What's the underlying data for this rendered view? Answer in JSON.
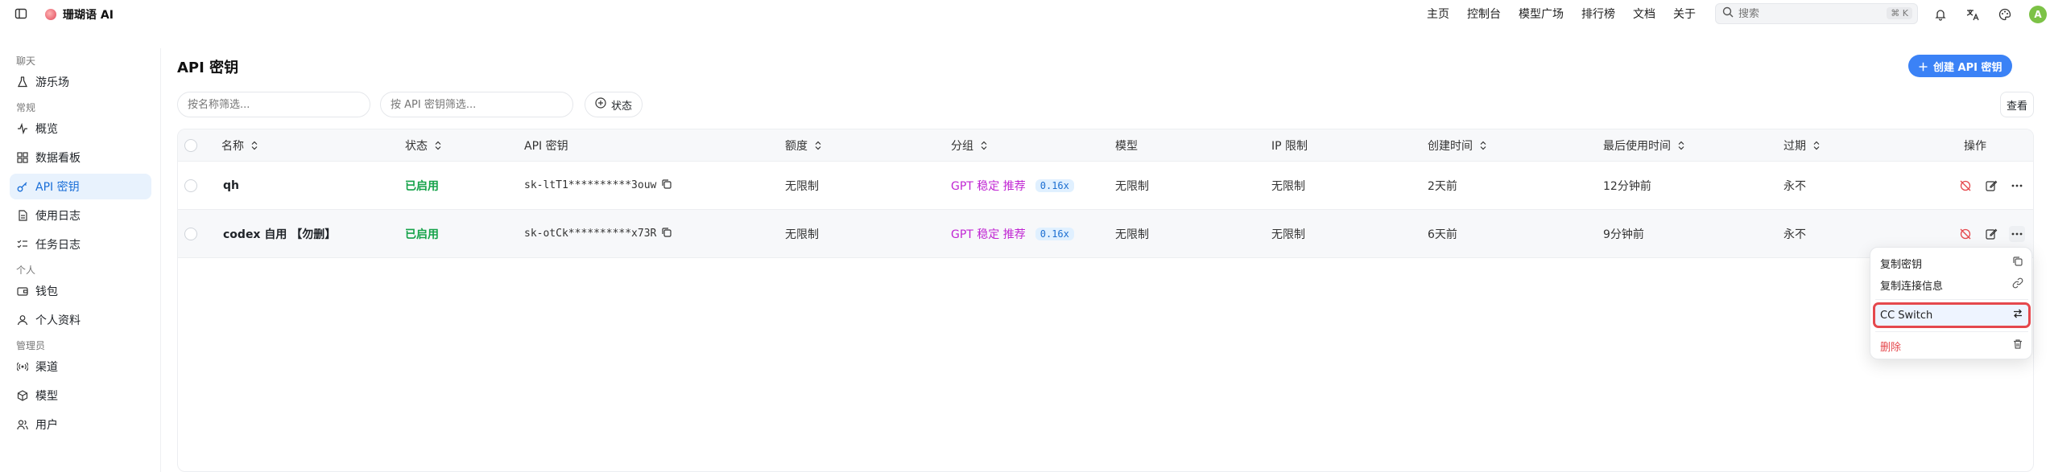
{
  "app": {
    "name": "珊瑚语 AI"
  },
  "topnav": {
    "links": [
      "主页",
      "控制台",
      "模型广场",
      "排行榜",
      "文档",
      "关于"
    ],
    "search_placeholder": "搜索",
    "search_shortcut": "⌘ K",
    "avatar_letter": "A"
  },
  "sidebar": {
    "groups": [
      {
        "label": "聊天",
        "items": [
          {
            "label": "游乐场",
            "icon": "flask-icon"
          }
        ]
      },
      {
        "label": "常规",
        "items": [
          {
            "label": "概览",
            "icon": "activity-icon"
          },
          {
            "label": "数据看板",
            "icon": "dashboard-icon"
          },
          {
            "label": "API 密钥",
            "icon": "key-icon",
            "active": true
          },
          {
            "label": "使用日志",
            "icon": "log-icon"
          },
          {
            "label": "任务日志",
            "icon": "task-list-icon"
          }
        ]
      },
      {
        "label": "个人",
        "items": [
          {
            "label": "钱包",
            "icon": "wallet-icon"
          },
          {
            "label": "个人资料",
            "icon": "user-icon"
          }
        ]
      },
      {
        "label": "管理员",
        "items": [
          {
            "label": "渠道",
            "icon": "radio-icon"
          },
          {
            "label": "模型",
            "icon": "cube-icon"
          },
          {
            "label": "用户",
            "icon": "users-icon"
          }
        ]
      }
    ]
  },
  "page": {
    "title": "API 密钥",
    "create_button": "创建 API 密钥",
    "filter_name_placeholder": "按名称筛选...",
    "filter_key_placeholder": "按 API 密钥筛选...",
    "status_filter_label": "状态",
    "view_button": "查看"
  },
  "table": {
    "columns": [
      "名称",
      "状态",
      "API 密钥",
      "额度",
      "分组",
      "模型",
      "IP 限制",
      "创建时间",
      "最后使用时间",
      "过期",
      "操作"
    ],
    "rows": [
      {
        "name": "qh",
        "status": "已启用",
        "key": "sk-ltT1**********3ouw",
        "quota": "无限制",
        "group": "GPT 稳定 推荐",
        "ratio": "0.16x",
        "models": "无限制",
        "ip_limit": "无限制",
        "created": "2天前",
        "last_used": "12分钟前",
        "expires": "永不"
      },
      {
        "name": "codex 自用 【勿删】",
        "status": "已启用",
        "key": "sk-otCk**********x73R",
        "quota": "无限制",
        "group": "GPT 稳定 推荐",
        "ratio": "0.16x",
        "models": "无限制",
        "ip_limit": "无限制",
        "created": "6天前",
        "last_used": "9分钟前",
        "expires": "永不"
      }
    ]
  },
  "menu": {
    "copy_key": "复制密钥",
    "copy_connection": "复制连接信息",
    "cc_switch": "CC Switch",
    "delete": "删除"
  },
  "colors": {
    "accent": "#3b82f6",
    "enabled": "#16a34a",
    "group": "#c026d3",
    "danger": "#e5484d",
    "highlight_box": "#e5484d"
  }
}
